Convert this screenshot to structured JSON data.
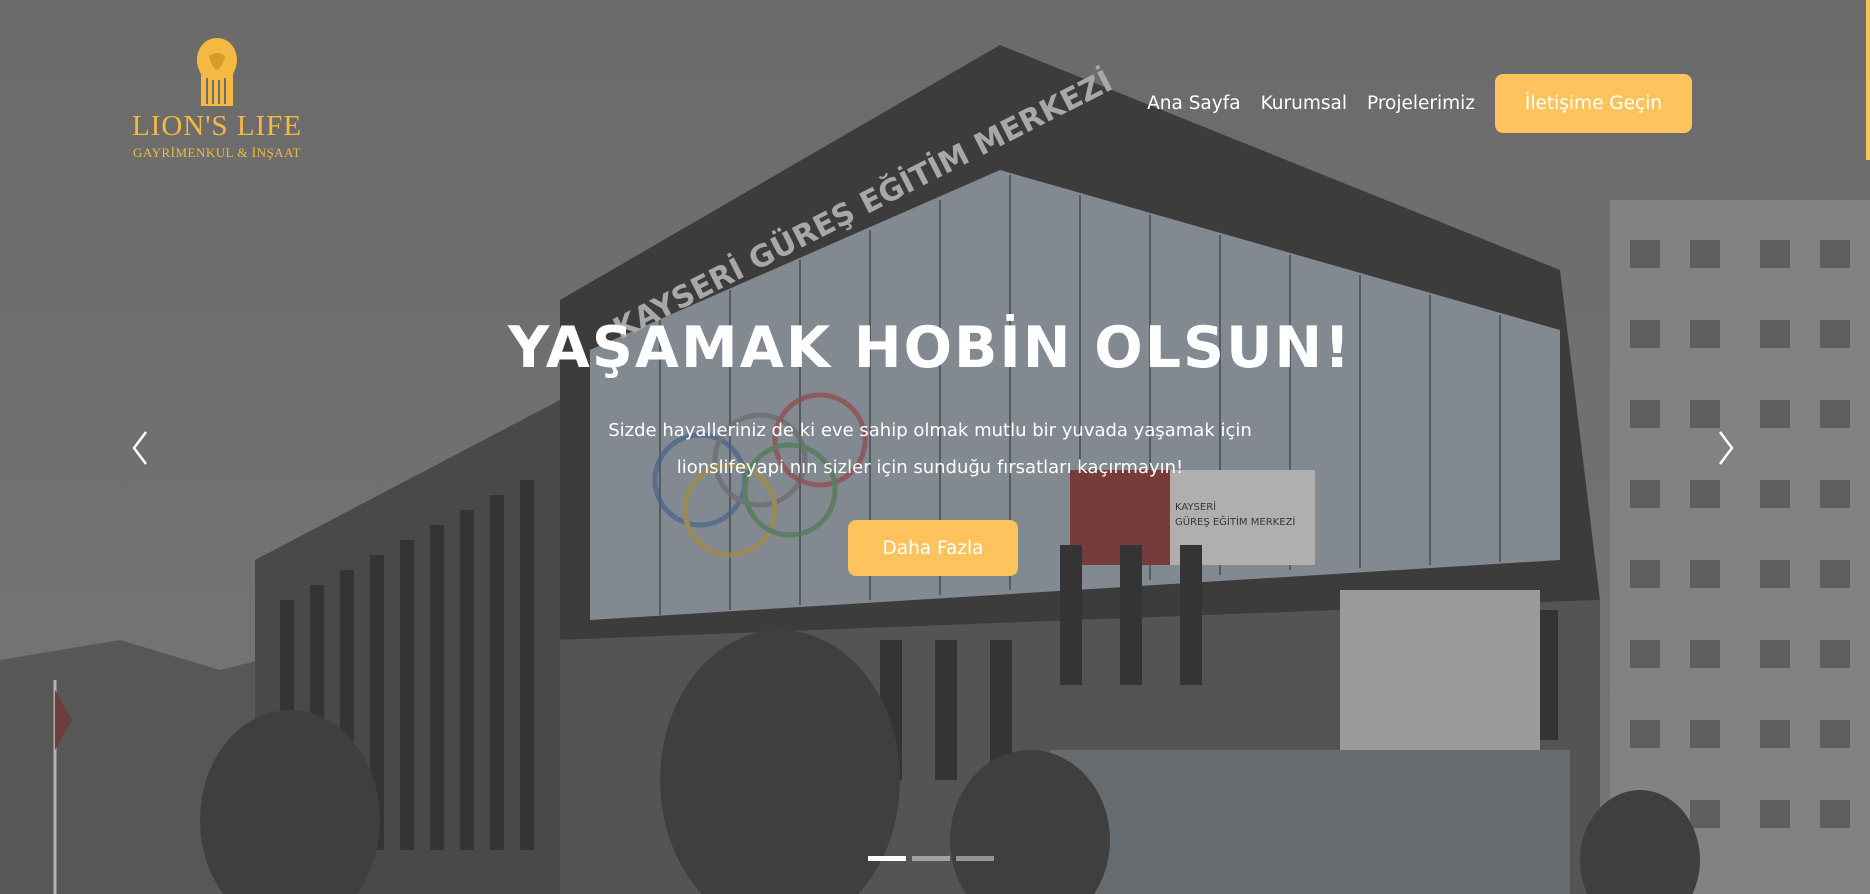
{
  "brand": {
    "name": "LION'S LIFE",
    "tagline": "GAYRİMENKUL & İNŞAAT",
    "accent_color": "#ffc35e"
  },
  "nav": {
    "items": [
      {
        "label": "Ana Sayfa"
      },
      {
        "label": "Kurumsal"
      },
      {
        "label": "Projelerimiz"
      }
    ],
    "contact_label": "İletişime Geçin"
  },
  "hero": {
    "headline": "YAŞAMAK HOBİN OLSUN!",
    "subtext_line1": "Sizde hayalleriniz de ki eve sahip olmak mutlu bir yuvada yaşamak için",
    "subtext_line2": "lionslifeyapi nın sizler için sunduğu fırsatları kaçırmayın!",
    "cta_label": "Daha Fazla",
    "background_sign": "KAYSERİ GÜREŞ EĞİTİM MERKEZİ"
  },
  "carousel": {
    "slide_count": 3,
    "active_index": 0,
    "prev_icon": "chevron-left-icon",
    "next_icon": "chevron-right-icon"
  }
}
